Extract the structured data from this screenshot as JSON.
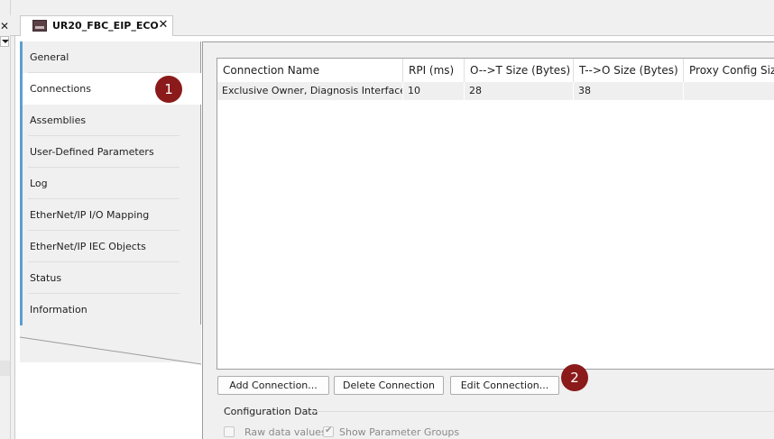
{
  "document_tab": {
    "title": "UR20_FBC_EIP_ECO",
    "close_glyph": "✕"
  },
  "left_pane": {
    "close_glyph": "✕"
  },
  "nav": {
    "items": [
      {
        "label": "General"
      },
      {
        "label": "Connections"
      },
      {
        "label": "Assemblies"
      },
      {
        "label": "User-Defined Parameters"
      },
      {
        "label": "Log"
      },
      {
        "label": "EtherNet/IP I/O Mapping"
      },
      {
        "label": "EtherNet/IP IEC Objects"
      },
      {
        "label": "Status"
      },
      {
        "label": "Information"
      }
    ],
    "active": "Connections"
  },
  "badges": {
    "one": "1",
    "two": "2",
    "color": "#8b1a1a"
  },
  "table": {
    "columns": [
      "Connection Name",
      "RPI (ms)",
      "O-->T Size (Bytes)",
      "T-->O Size (Bytes)",
      "Proxy Config Size"
    ],
    "rows": [
      [
        "Exclusive Owner, Diagnosis Interface",
        "10",
        "28",
        "38",
        ""
      ]
    ]
  },
  "buttons": {
    "add": "Add Connection...",
    "delete": "Delete Connection",
    "edit": "Edit Connection..."
  },
  "config": {
    "group_label": "Configuration Data",
    "raw_values_label": "Raw data values",
    "raw_values_checked": false,
    "show_groups_label": "Show Parameter Groups",
    "show_groups_checked": true
  },
  "colors": {
    "accent": "#5a9fd4",
    "badge": "#8b1a1a"
  }
}
